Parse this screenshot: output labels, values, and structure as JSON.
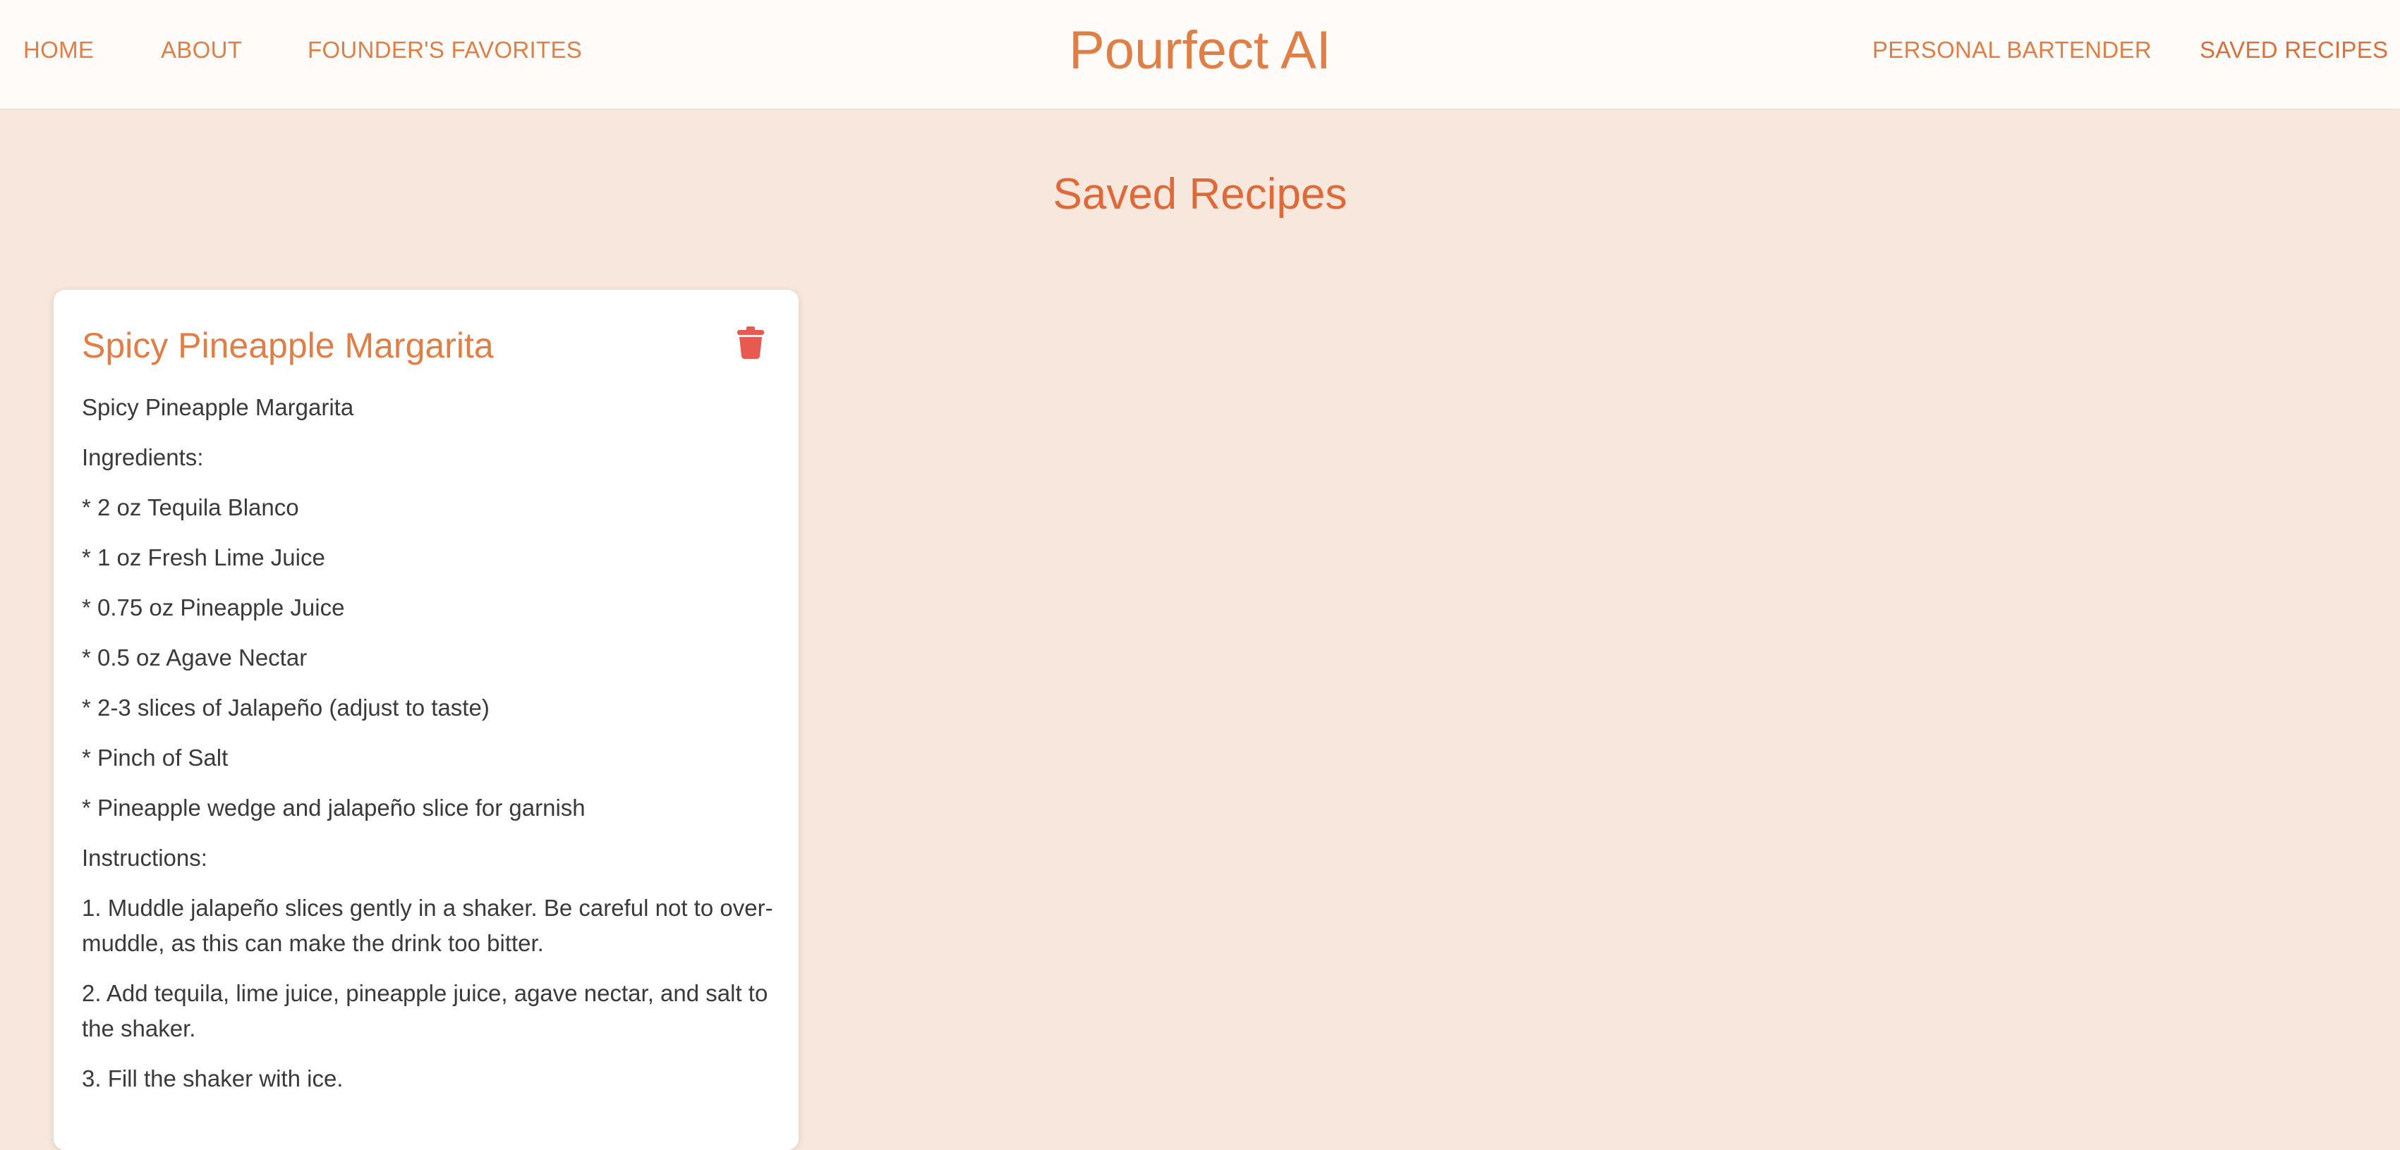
{
  "nav": {
    "left": [
      "HOME",
      "ABOUT",
      "FOUNDER'S FAVORITES"
    ],
    "right": [
      "PERSONAL BARTENDER",
      "SAVED RECIPES"
    ],
    "brand": "Pourfect AI",
    "active": "SAVED RECIPES"
  },
  "page": {
    "title": "Saved Recipes"
  },
  "recipes": [
    {
      "title": "Spicy Pineapple Margarita",
      "delete_icon": "trash-icon",
      "lines": [
        "Spicy Pineapple Margarita",
        "Ingredients:",
        "* 2 oz Tequila Blanco",
        "* 1 oz Fresh Lime Juice",
        "* 0.75 oz Pineapple Juice",
        "* 0.5 oz Agave Nectar",
        "* 2-3 slices of Jalapeño (adjust to taste)",
        "* Pinch of Salt",
        "* Pineapple wedge and jalapeño slice for garnish",
        "Instructions:",
        "1. Muddle jalapeño slices gently in a shaker. Be careful not to over-muddle, as this can make the drink too bitter.",
        "2. Add tequila, lime juice, pineapple juice, agave nectar, and salt to the shaker.",
        "3. Fill the shaker with ice."
      ]
    }
  ],
  "colors": {
    "accent": "#e07f45",
    "title": "#dd6a38",
    "background": "#f7e7dc",
    "navbar": "#fffbf8",
    "card": "#ffffff",
    "delete": "#e8594f",
    "text": "#3a3a3a"
  }
}
